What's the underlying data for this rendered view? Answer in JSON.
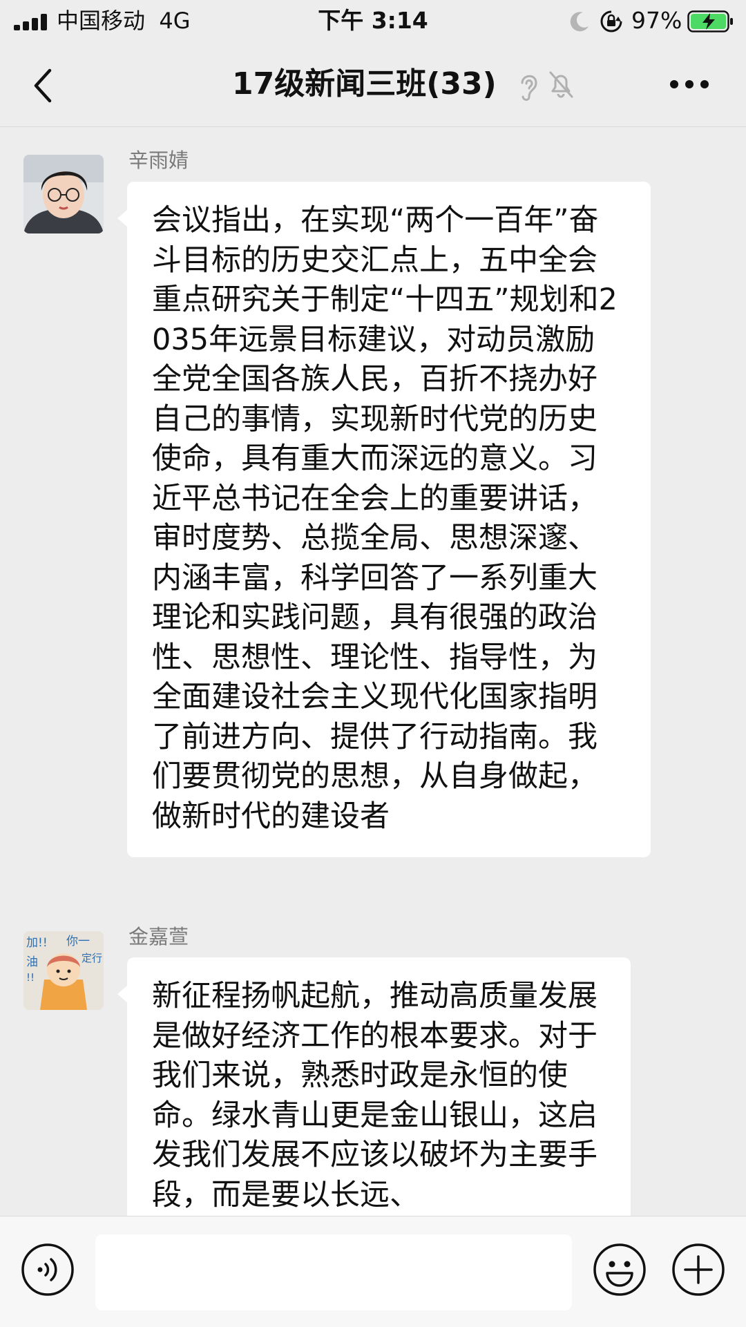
{
  "status_bar": {
    "carrier": "中国移动",
    "network": "4G",
    "time": "下午 3:14",
    "battery_percent": "97%"
  },
  "nav": {
    "title": "17级新闻三班(33)",
    "back_icon": "chevron-left-icon",
    "more_icon": "ellipsis-icon",
    "status_icons": [
      "ear-icon",
      "muted-bell-icon"
    ]
  },
  "messages": [
    {
      "sender": "辛雨婧",
      "text": "会议指出，在实现“两个一百年”奋斗目标的历史交汇点上，五中全会重点研究关于制定“十四五”规划和2035年远景目标建议，对动员激励全党全国各族人民，百折不挠办好自己的事情，实现新时代党的历史使命，具有重大而深远的意义。习近平总书记在全会上的重要讲话，审时度势、总揽全局、思想深邃、内涵丰富，科学回答了一系列重大理论和实践问题，具有很强的政治性、思想性、理论性、指导性，为全面建设社会主义现代化国家指明了前进方向、提供了行动指南。我们要贯彻党的思想，从自身做起，做新时代的建设者"
    },
    {
      "sender": "金嘉萱",
      "avatar_text": [
        "加!!",
        "你一",
        "油",
        "定行",
        "!!"
      ],
      "text": "新征程扬帆起航，推动高质量发展是做好经济工作的根本要求。对于我们来说，熟悉时政是永恒的使命。绿水青山更是金山银山，这启发我们发展不应该以破坏为主要手段，而是要以长远、"
    }
  ],
  "input_bar": {
    "voice_icon": "voice-icon",
    "emoji_icon": "emoji-icon",
    "plus_icon": "plus-icon",
    "value": ""
  },
  "colors": {
    "background": "#ededed",
    "bubble": "#ffffff",
    "battery_green": "#4cd964"
  }
}
